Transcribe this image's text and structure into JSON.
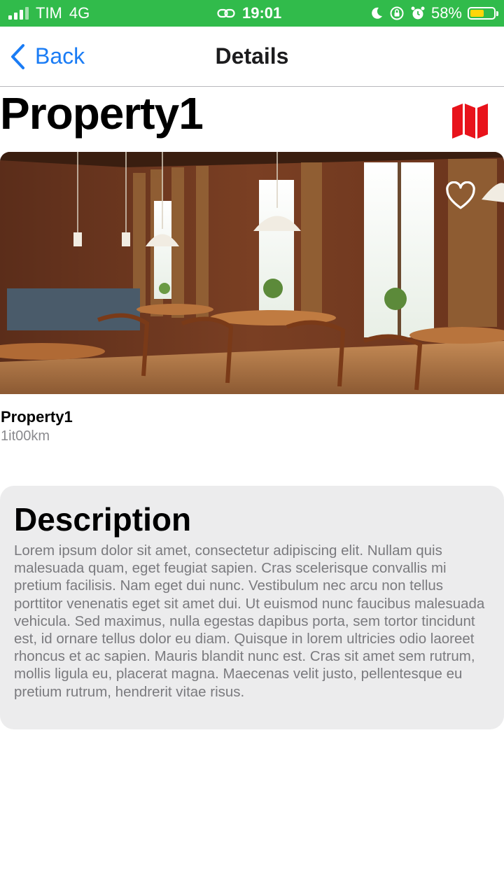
{
  "status_bar": {
    "carrier": "TIM",
    "network": "4G",
    "time": "19:01",
    "battery": "58%",
    "battery_level": 0.58,
    "icons": [
      "signal-icon",
      "link-icon",
      "moon-icon",
      "rotation-lock-icon",
      "alarm-icon",
      "battery-icon"
    ]
  },
  "nav": {
    "back_label": "Back",
    "title": "Details"
  },
  "property": {
    "title": "Property1",
    "name": "Property1",
    "distance": "1it00km"
  },
  "icons": {
    "map": "map-icon",
    "favorite": "heart-outline-icon"
  },
  "colors": {
    "status_bar": "#31bb4b",
    "accent": "#1a7cf5",
    "map_icon": "#e8131b",
    "card_bg": "#ececed"
  },
  "description": {
    "title": "Description",
    "body": "Lorem ipsum dolor sit amet, consectetur adipiscing elit. Nullam quis malesuada quam, eget feugiat sapien. Cras scelerisque convallis mi pretium facilisis. Nam eget dui nunc. Vestibulum nec arcu non tellus porttitor venenatis eget sit amet dui. Ut euismod nunc faucibus malesuada vehicula. Sed maximus, nulla egestas dapibus porta, sem tortor tincidunt est, id ornare tellus dolor eu diam. Quisque in lorem ultricies odio laoreet rhoncus et ac sapien. Mauris blandit nunc est. Cras sit amet sem rutrum, mollis ligula eu, placerat magna. Maecenas velit justo, pellentesque eu pretium rutrum, hendrerit vitae risus."
  }
}
